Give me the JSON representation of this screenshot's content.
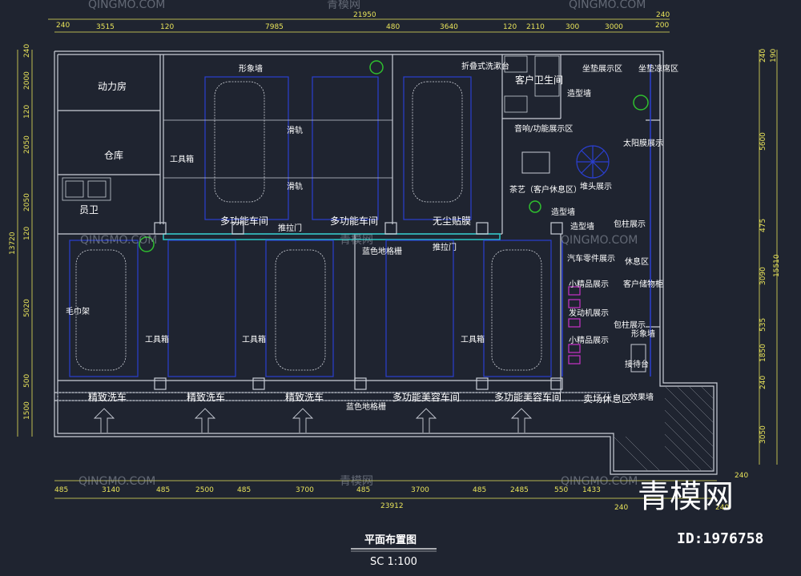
{
  "top_dims": {
    "overall": "21950",
    "left": "240",
    "right": "240",
    "segments": [
      "3515",
      "120",
      "7985",
      "480",
      "3640",
      "120",
      "2110",
      "300",
      "3000",
      "200"
    ]
  },
  "bottom_dims": {
    "overall": "23912",
    "segments": [
      "485",
      "3140",
      "485",
      "2500",
      "485",
      "3700",
      "485",
      "3700",
      "485",
      "2485",
      "550",
      "1433"
    ],
    "right_a": "240",
    "right_b": "240",
    "right_c": "240"
  },
  "left_dims": {
    "overall": "13720",
    "segments": [
      "240",
      "2000",
      "120",
      "2050",
      "2050",
      "120",
      "5020",
      "500",
      "1500"
    ]
  },
  "right_dims": {
    "top_a": "240",
    "top_b": "190",
    "segments": [
      "5600",
      "475",
      "3090",
      "535",
      "1850",
      "240",
      "3050"
    ],
    "overall": "15510"
  },
  "rooms": {
    "power_room": "动力房",
    "warehouse": "仓库",
    "staff_wc": "员卫",
    "towel_rack": "毛巾架",
    "image_wall_top": "形象墙",
    "slide_rail_1": "滑轨",
    "slide_rail_2": "滑轨",
    "tool_cabinet": "工具箱",
    "multi_workshop_1": "多功能车间",
    "multi_workshop_2": "多功能车间",
    "dust_free_film": "无尘贴膜",
    "sliding_door_1": "推拉门",
    "sliding_door_2": "推拉门",
    "blue_grate_top": "蓝色地格栅",
    "blue_grate_bottom": "蓝色地格栅",
    "tool_box_1": "工具箱",
    "tool_box_2": "工具箱",
    "tool_box_3": "工具箱",
    "fine_wash_1": "精致洗车",
    "fine_wash_2": "精致洗车",
    "fine_wash_3": "精致洗车",
    "beauty_workshop_1": "多功能美容车间",
    "beauty_workshop_2": "多功能美容车间",
    "folding_desk": "折叠式洗漱台",
    "customer_wc": "客户卫生间",
    "styling_wall_1": "造型墙",
    "audio_display": "音响/功能展示区",
    "seat_display": "坐垫展示区",
    "seat_cushion_display": "坐垫凉席区",
    "sunshade_display": "太阳膜展示",
    "tea_area": "茶艺（客户休息区）",
    "pile_display": "堆头展示",
    "styling_wall_2": "造型墙",
    "styling_wall_3": "造型墙",
    "pillar_display_1": "包柱展示",
    "parts_display": "汽车零件展示",
    "lounge": "休息区",
    "boutique_1": "小精品展示",
    "customer_storage": "客户储物柜",
    "engine_display": "发动机展示",
    "pillar_display_2": "包柱展示",
    "image_wall_right": "形象墙",
    "boutique_2": "小精品展示",
    "reception": "接待台",
    "store_lounge": "卖场休息区",
    "effect_wall": "效果墙"
  },
  "watermark": {
    "latin": "QINGMO.COM",
    "cn": "青模网"
  },
  "footer": {
    "title": "平面布置图",
    "scale": "SC 1:100",
    "brand": "青模网",
    "id": "ID:1976758"
  },
  "colors": {
    "background": "#1f2430",
    "wall": "#c9cdd6",
    "dimension": "#e8e35a",
    "furniture": "#2a3fd1",
    "grate": "#29c6c6",
    "plant": "#2fbf2f",
    "magenta": "#c832c8"
  }
}
